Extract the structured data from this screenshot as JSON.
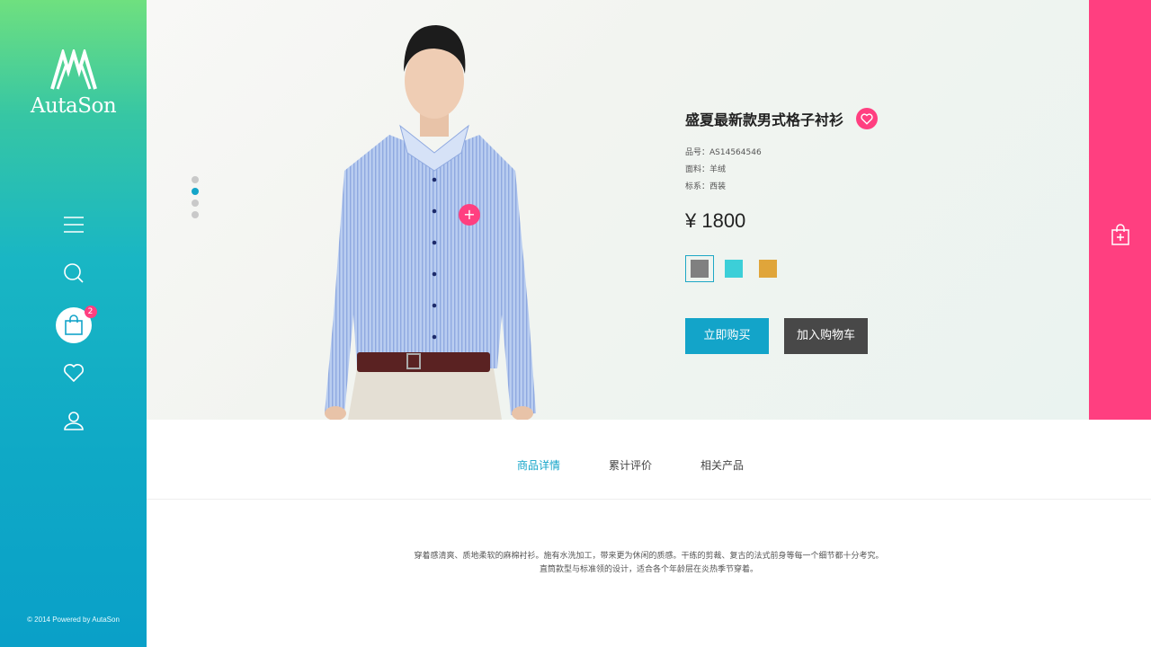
{
  "brand": {
    "name": "AutaSon",
    "footer": "© 2014 Powered by AutaSon"
  },
  "sidebar": {
    "nav": [
      {
        "icon": "menu-icon"
      },
      {
        "icon": "search-icon"
      },
      {
        "icon": "shopping-bag-icon",
        "badge": "2"
      },
      {
        "icon": "heart-icon"
      },
      {
        "icon": "user-icon"
      }
    ]
  },
  "carousel": {
    "dots": 4,
    "active_index": 1
  },
  "product": {
    "title": "盛夏最新款男式格子衬衫",
    "sku": "品号：AS14564546",
    "fabric": "面料：羊绒",
    "series": "标系：西装",
    "price": "¥ 1800",
    "colors": [
      "#808080",
      "#3ccfd8",
      "#e0a53a"
    ],
    "selected_color_index": 0
  },
  "actions": {
    "buy_now": "立即购买",
    "add_to_cart": "加入购物车"
  },
  "tabs": [
    {
      "label": "商品详情",
      "active": true
    },
    {
      "label": "累计评价",
      "active": false
    },
    {
      "label": "相关产品",
      "active": false
    }
  ],
  "description": {
    "line1": "穿着感清爽、质地柔软的麻棉衬衫。施有水洗加工，带来更为休闲的质感。干练的剪裁、复古的法式前身等每一个细节都十分考究。",
    "line2": "直筒款型与标准领的设计，适合各个年龄层在炎热季节穿着。"
  },
  "colors": {
    "accent": "#13a4c9",
    "pink": "#ff3f80",
    "dark_button": "#484848"
  }
}
